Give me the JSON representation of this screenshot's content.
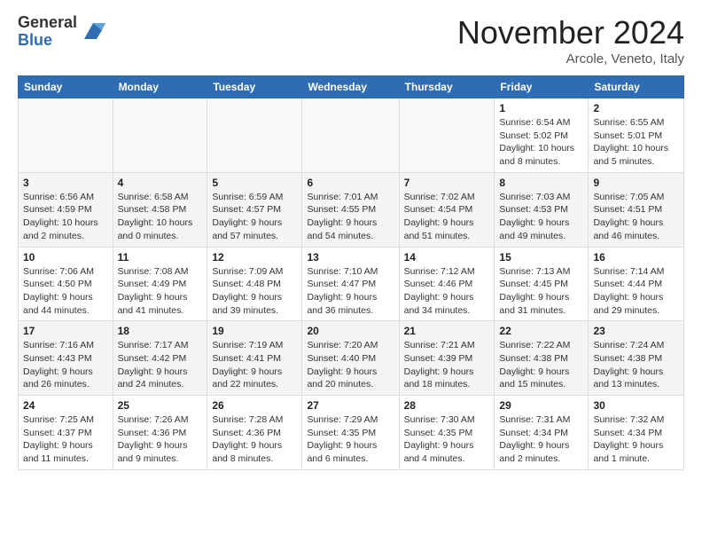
{
  "header": {
    "logo_general": "General",
    "logo_blue": "Blue",
    "month_title": "November 2024",
    "location": "Arcole, Veneto, Italy"
  },
  "days_of_week": [
    "Sunday",
    "Monday",
    "Tuesday",
    "Wednesday",
    "Thursday",
    "Friday",
    "Saturday"
  ],
  "weeks": [
    [
      {
        "day": "",
        "info": ""
      },
      {
        "day": "",
        "info": ""
      },
      {
        "day": "",
        "info": ""
      },
      {
        "day": "",
        "info": ""
      },
      {
        "day": "",
        "info": ""
      },
      {
        "day": "1",
        "info": "Sunrise: 6:54 AM\nSunset: 5:02 PM\nDaylight: 10 hours\nand 8 minutes."
      },
      {
        "day": "2",
        "info": "Sunrise: 6:55 AM\nSunset: 5:01 PM\nDaylight: 10 hours\nand 5 minutes."
      }
    ],
    [
      {
        "day": "3",
        "info": "Sunrise: 6:56 AM\nSunset: 4:59 PM\nDaylight: 10 hours\nand 2 minutes."
      },
      {
        "day": "4",
        "info": "Sunrise: 6:58 AM\nSunset: 4:58 PM\nDaylight: 10 hours\nand 0 minutes."
      },
      {
        "day": "5",
        "info": "Sunrise: 6:59 AM\nSunset: 4:57 PM\nDaylight: 9 hours\nand 57 minutes."
      },
      {
        "day": "6",
        "info": "Sunrise: 7:01 AM\nSunset: 4:55 PM\nDaylight: 9 hours\nand 54 minutes."
      },
      {
        "day": "7",
        "info": "Sunrise: 7:02 AM\nSunset: 4:54 PM\nDaylight: 9 hours\nand 51 minutes."
      },
      {
        "day": "8",
        "info": "Sunrise: 7:03 AM\nSunset: 4:53 PM\nDaylight: 9 hours\nand 49 minutes."
      },
      {
        "day": "9",
        "info": "Sunrise: 7:05 AM\nSunset: 4:51 PM\nDaylight: 9 hours\nand 46 minutes."
      }
    ],
    [
      {
        "day": "10",
        "info": "Sunrise: 7:06 AM\nSunset: 4:50 PM\nDaylight: 9 hours\nand 44 minutes."
      },
      {
        "day": "11",
        "info": "Sunrise: 7:08 AM\nSunset: 4:49 PM\nDaylight: 9 hours\nand 41 minutes."
      },
      {
        "day": "12",
        "info": "Sunrise: 7:09 AM\nSunset: 4:48 PM\nDaylight: 9 hours\nand 39 minutes."
      },
      {
        "day": "13",
        "info": "Sunrise: 7:10 AM\nSunset: 4:47 PM\nDaylight: 9 hours\nand 36 minutes."
      },
      {
        "day": "14",
        "info": "Sunrise: 7:12 AM\nSunset: 4:46 PM\nDaylight: 9 hours\nand 34 minutes."
      },
      {
        "day": "15",
        "info": "Sunrise: 7:13 AM\nSunset: 4:45 PM\nDaylight: 9 hours\nand 31 minutes."
      },
      {
        "day": "16",
        "info": "Sunrise: 7:14 AM\nSunset: 4:44 PM\nDaylight: 9 hours\nand 29 minutes."
      }
    ],
    [
      {
        "day": "17",
        "info": "Sunrise: 7:16 AM\nSunset: 4:43 PM\nDaylight: 9 hours\nand 26 minutes."
      },
      {
        "day": "18",
        "info": "Sunrise: 7:17 AM\nSunset: 4:42 PM\nDaylight: 9 hours\nand 24 minutes."
      },
      {
        "day": "19",
        "info": "Sunrise: 7:19 AM\nSunset: 4:41 PM\nDaylight: 9 hours\nand 22 minutes."
      },
      {
        "day": "20",
        "info": "Sunrise: 7:20 AM\nSunset: 4:40 PM\nDaylight: 9 hours\nand 20 minutes."
      },
      {
        "day": "21",
        "info": "Sunrise: 7:21 AM\nSunset: 4:39 PM\nDaylight: 9 hours\nand 18 minutes."
      },
      {
        "day": "22",
        "info": "Sunrise: 7:22 AM\nSunset: 4:38 PM\nDaylight: 9 hours\nand 15 minutes."
      },
      {
        "day": "23",
        "info": "Sunrise: 7:24 AM\nSunset: 4:38 PM\nDaylight: 9 hours\nand 13 minutes."
      }
    ],
    [
      {
        "day": "24",
        "info": "Sunrise: 7:25 AM\nSunset: 4:37 PM\nDaylight: 9 hours\nand 11 minutes."
      },
      {
        "day": "25",
        "info": "Sunrise: 7:26 AM\nSunset: 4:36 PM\nDaylight: 9 hours\nand 9 minutes."
      },
      {
        "day": "26",
        "info": "Sunrise: 7:28 AM\nSunset: 4:36 PM\nDaylight: 9 hours\nand 8 minutes."
      },
      {
        "day": "27",
        "info": "Sunrise: 7:29 AM\nSunset: 4:35 PM\nDaylight: 9 hours\nand 6 minutes."
      },
      {
        "day": "28",
        "info": "Sunrise: 7:30 AM\nSunset: 4:35 PM\nDaylight: 9 hours\nand 4 minutes."
      },
      {
        "day": "29",
        "info": "Sunrise: 7:31 AM\nSunset: 4:34 PM\nDaylight: 9 hours\nand 2 minutes."
      },
      {
        "day": "30",
        "info": "Sunrise: 7:32 AM\nSunset: 4:34 PM\nDaylight: 9 hours\nand 1 minute."
      }
    ]
  ]
}
